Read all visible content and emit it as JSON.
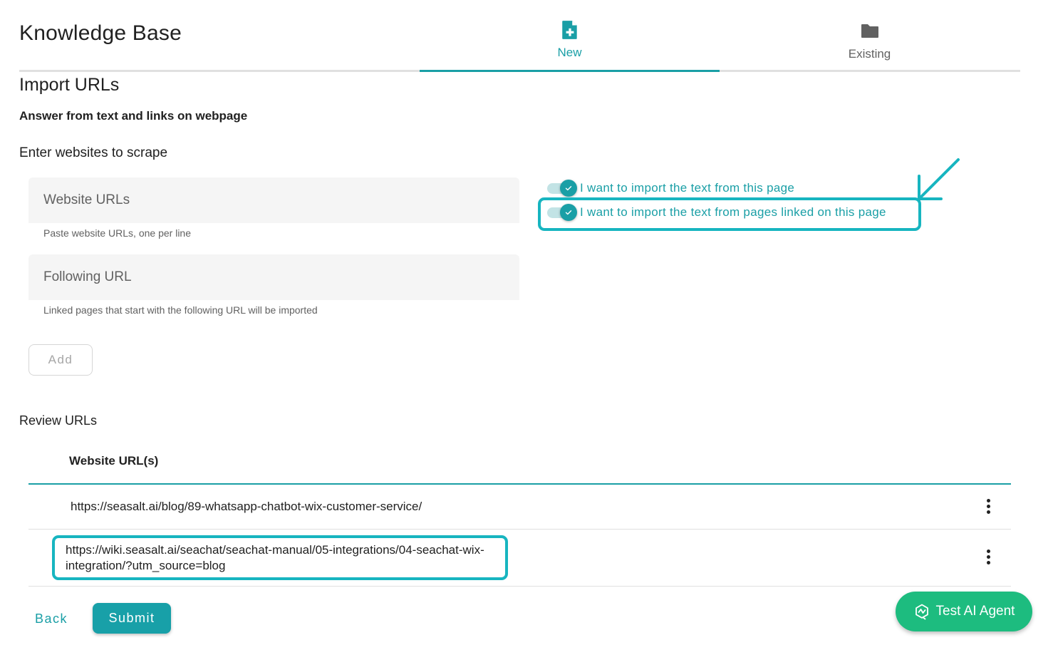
{
  "header": {
    "title": "Knowledge Base"
  },
  "tabs": [
    {
      "label": "New",
      "icon": "file-plus-icon",
      "active": true
    },
    {
      "label": "Existing",
      "icon": "folder-icon",
      "active": false
    }
  ],
  "form": {
    "section_title": "Import URLs",
    "subtitle": "Answer from text and links on webpage",
    "enter_label": "Enter websites to scrape",
    "website_urls": {
      "placeholder": "Website URLs",
      "value": "",
      "hint": "Paste website URLs, one per line"
    },
    "following_url": {
      "placeholder": "Following URL",
      "value": "",
      "hint": "Linked pages that start with the following URL will be imported"
    },
    "add_label": "Add",
    "toggles": [
      {
        "label": "I want to import the text from this page",
        "checked": true
      },
      {
        "label": "I want to import the text from pages linked on this page",
        "checked": true
      }
    ]
  },
  "review": {
    "label": "Review URLs",
    "column_header": "Website URL(s)",
    "rows": [
      {
        "url": "https://seasalt.ai/blog/89-whatsapp-chatbot-wix-customer-service/"
      },
      {
        "url": "https://wiki.seasalt.ai/seachat/seachat-manual/05-integrations/04-seachat-wix-integration/?utm_source=blog"
      }
    ]
  },
  "footer": {
    "back_label": "Back",
    "submit_label": "Submit"
  },
  "fab": {
    "label": "Test AI Agent",
    "icon": "ai-agent-icon"
  },
  "colors": {
    "accent": "#1a9fa6",
    "highlight": "#17b5c0",
    "fab": "#1dbc7f"
  }
}
